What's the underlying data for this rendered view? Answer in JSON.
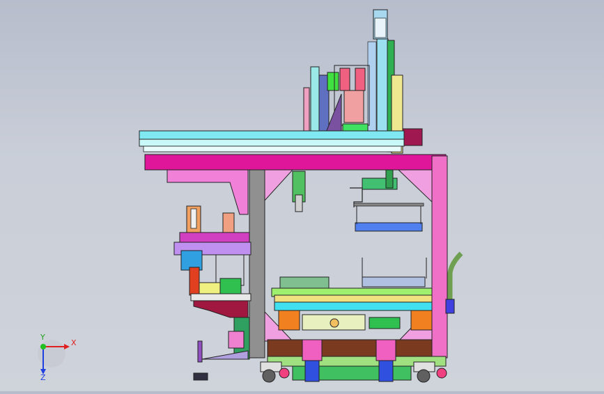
{
  "viewport": {
    "background_top": "#b7bdcc",
    "background_bottom": "#cfd3da"
  },
  "triad": {
    "x_label": "X",
    "y_label": "Y",
    "z_label": "Z",
    "x_color": "#e02020",
    "y_color": "#20c020",
    "z_color": "#2040e0"
  },
  "colors": {
    "magenta": "#e0169a",
    "pink": "#f090d0",
    "cyan": "#40e0f0",
    "lightcyan": "#a0f0f0",
    "green": "#30c060",
    "lime": "#a0f050",
    "yellow": "#f0e060",
    "orange": "#f08020",
    "purple": "#8040c0",
    "gray": "#909090",
    "darkred": "#a02040",
    "blue": "#4060f0",
    "brown": "#7a3a20"
  }
}
